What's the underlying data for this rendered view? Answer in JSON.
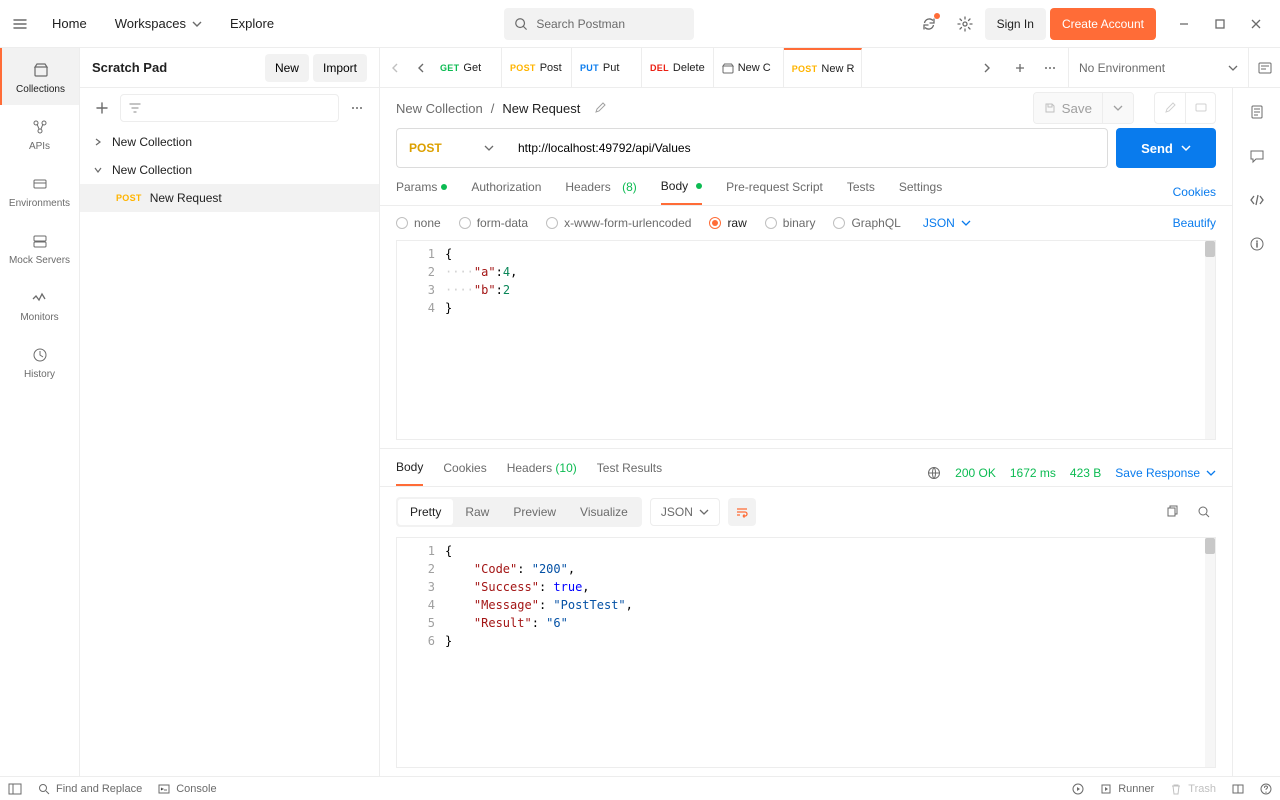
{
  "top": {
    "nav": {
      "home": "Home",
      "workspaces": "Workspaces",
      "explore": "Explore"
    },
    "search_placeholder": "Search Postman",
    "sign_in": "Sign In",
    "create_account": "Create Account"
  },
  "left_rail": {
    "collections": "Collections",
    "apis": "APIs",
    "environments": "Environments",
    "mock_servers": "Mock Servers",
    "monitors": "Monitors",
    "history": "History"
  },
  "scratch": {
    "title": "Scratch Pad",
    "new": "New",
    "import": "Import"
  },
  "tree": {
    "coll1": "New Collection",
    "coll2": "New Collection",
    "req1_method": "POST",
    "req1_name": "New Request"
  },
  "tabs": {
    "t1_method": "GET",
    "t1_name": "Get",
    "t2_method": "POST",
    "t2_name": "Post",
    "t3_method": "PUT",
    "t3_name": "Put",
    "t4_method": "DEL",
    "t4_name": "Delete",
    "t5_name": "New C",
    "t6_method": "POST",
    "t6_name": "New R"
  },
  "env": {
    "none": "No Environment"
  },
  "breadcrumb": {
    "collection": "New Collection",
    "request": "New Request",
    "save": "Save"
  },
  "request": {
    "method": "POST",
    "url": "http://localhost:49792/api/Values",
    "send": "Send"
  },
  "req_tabs": {
    "params": "Params",
    "authorization": "Authorization",
    "headers": "Headers",
    "headers_count": "(8)",
    "body": "Body",
    "prerequest": "Pre-request Script",
    "tests": "Tests",
    "settings": "Settings",
    "cookies": "Cookies"
  },
  "body_types": {
    "none": "none",
    "formdata": "form-data",
    "urlencoded": "x-www-form-urlencoded",
    "raw": "raw",
    "binary": "binary",
    "graphql": "GraphQL",
    "lang": "JSON",
    "beautify": "Beautify"
  },
  "req_body_lines": {
    "l1": "{",
    "l2_key": "\"a\"",
    "l2_val": "4",
    "l3_key": "\"b\"",
    "l3_val": "2",
    "l4": "}"
  },
  "resp_tabs": {
    "body": "Body",
    "cookies": "Cookies",
    "headers": "Headers",
    "headers_count": "(10)",
    "tests": "Test Results"
  },
  "resp_meta": {
    "status": "200 OK",
    "time": "1672 ms",
    "size": "423 B",
    "save": "Save Response"
  },
  "resp_toolbar": {
    "pretty": "Pretty",
    "raw": "Raw",
    "preview": "Preview",
    "visualize": "Visualize",
    "lang": "JSON"
  },
  "resp_body": {
    "l2_k": "\"Code\"",
    "l2_v": "\"200\"",
    "l3_k": "\"Success\"",
    "l3_v": "true",
    "l4_k": "\"Message\"",
    "l4_v": "\"PostTest\"",
    "l5_k": "\"Result\"",
    "l5_v": "\"6\""
  },
  "status": {
    "find": "Find and Replace",
    "console": "Console",
    "runner": "Runner",
    "trash": "Trash"
  }
}
